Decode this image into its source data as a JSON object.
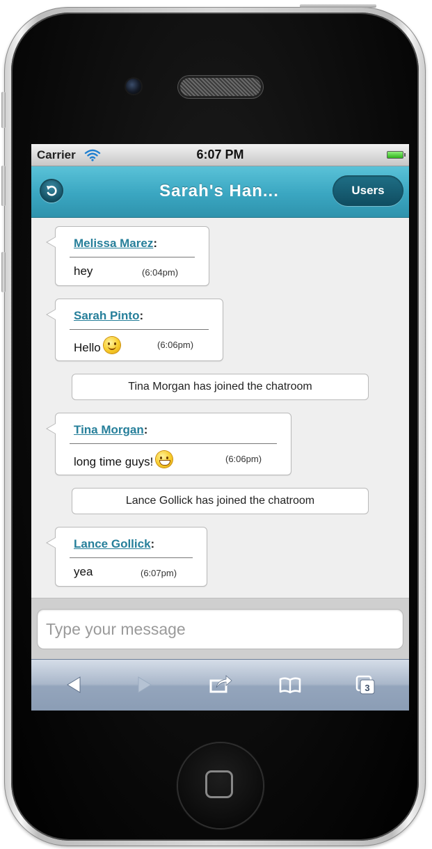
{
  "status_bar": {
    "carrier": "Carrier",
    "time": "6:07 PM"
  },
  "header": {
    "title": "Sarah's Han...",
    "users_label": "Users"
  },
  "messages": [
    {
      "sender": "Melissa Marez",
      "text": "hey",
      "time": "(6:04pm)",
      "emoji": ""
    },
    {
      "sender": "Sarah Pinto",
      "text": "Hello",
      "time": "(6:06pm)",
      "emoji": "smile-emoji-icon"
    },
    {
      "sender": "Tina Morgan",
      "text": "long time guys!",
      "time": "(6:06pm)",
      "emoji": "grin-emoji-icon"
    },
    {
      "sender": "Lance Gollick",
      "text": "yea",
      "time": "(6:07pm)",
      "emoji": ""
    }
  ],
  "notices": [
    "Tina Morgan has joined the chatroom",
    "Lance Gollick has joined the chatroom"
  ],
  "input": {
    "placeholder": "Type your message",
    "value": ""
  },
  "toolbar": {
    "icons": [
      "back-arrow-icon",
      "forward-arrow-icon",
      "share-icon",
      "bookmarks-icon",
      "tabs-icon"
    ],
    "tabs_count": "3"
  },
  "colors": {
    "header": "#3aa6c1",
    "link": "#267f9a",
    "users_button": "#0f4c60",
    "toolbar": "#a9b7ca"
  }
}
